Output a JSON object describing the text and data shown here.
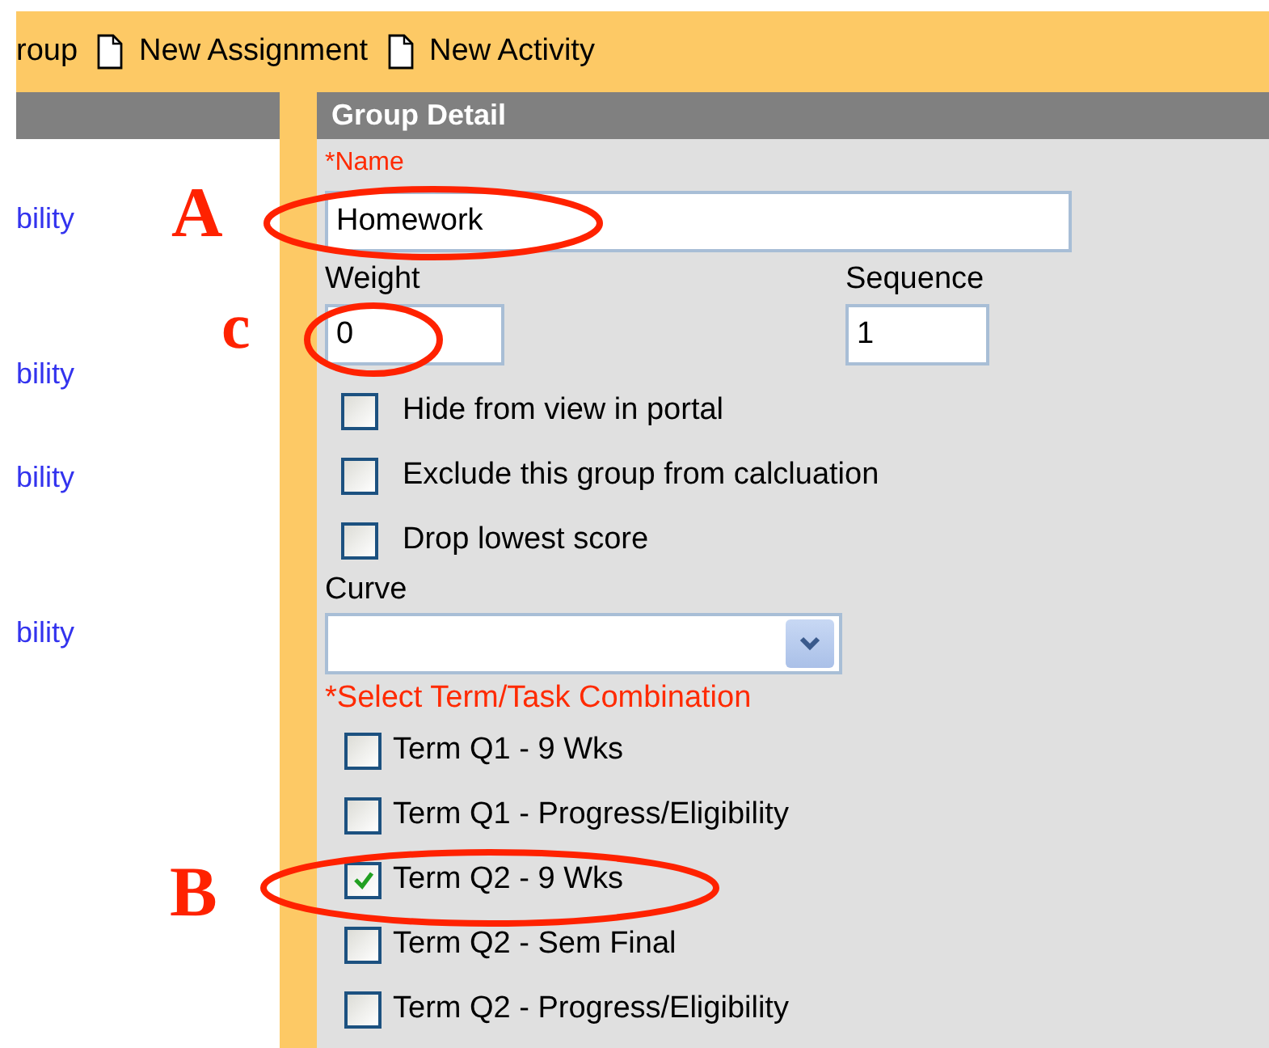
{
  "toolbar": {
    "items": [
      {
        "label": "roup",
        "icon": false
      },
      {
        "label": "New Assignment",
        "icon": true
      },
      {
        "label": "New Activity",
        "icon": true
      }
    ]
  },
  "left_panel": {
    "links": [
      "bility",
      "bility",
      "bility",
      "bility"
    ]
  },
  "group_detail": {
    "title": "Group Detail",
    "name": {
      "label": "*Name",
      "value": "Homework"
    },
    "weight": {
      "label": "Weight",
      "value": "0"
    },
    "sequence": {
      "label": "Sequence",
      "value": "1"
    },
    "options": [
      {
        "label": "Hide from view in portal",
        "checked": false
      },
      {
        "label": "Exclude this group from calcluation",
        "checked": false
      },
      {
        "label": "Drop lowest score",
        "checked": false
      }
    ],
    "curve": {
      "label": "Curve"
    },
    "term_task": {
      "label": "*Select Term/Task Combination",
      "items": [
        {
          "label": "Term Q1 - 9 Wks",
          "checked": false
        },
        {
          "label": "Term Q1 - Progress/Eligibility",
          "checked": false
        },
        {
          "label": "Term Q2 - 9 Wks",
          "checked": true
        },
        {
          "label": "Term Q2 - Sem Final",
          "checked": false
        },
        {
          "label": "Term Q2 - Progress/Eligibility",
          "checked": false
        }
      ]
    }
  },
  "annotations": [
    {
      "letter": "A"
    },
    {
      "letter": "c"
    },
    {
      "letter": "B"
    }
  ]
}
